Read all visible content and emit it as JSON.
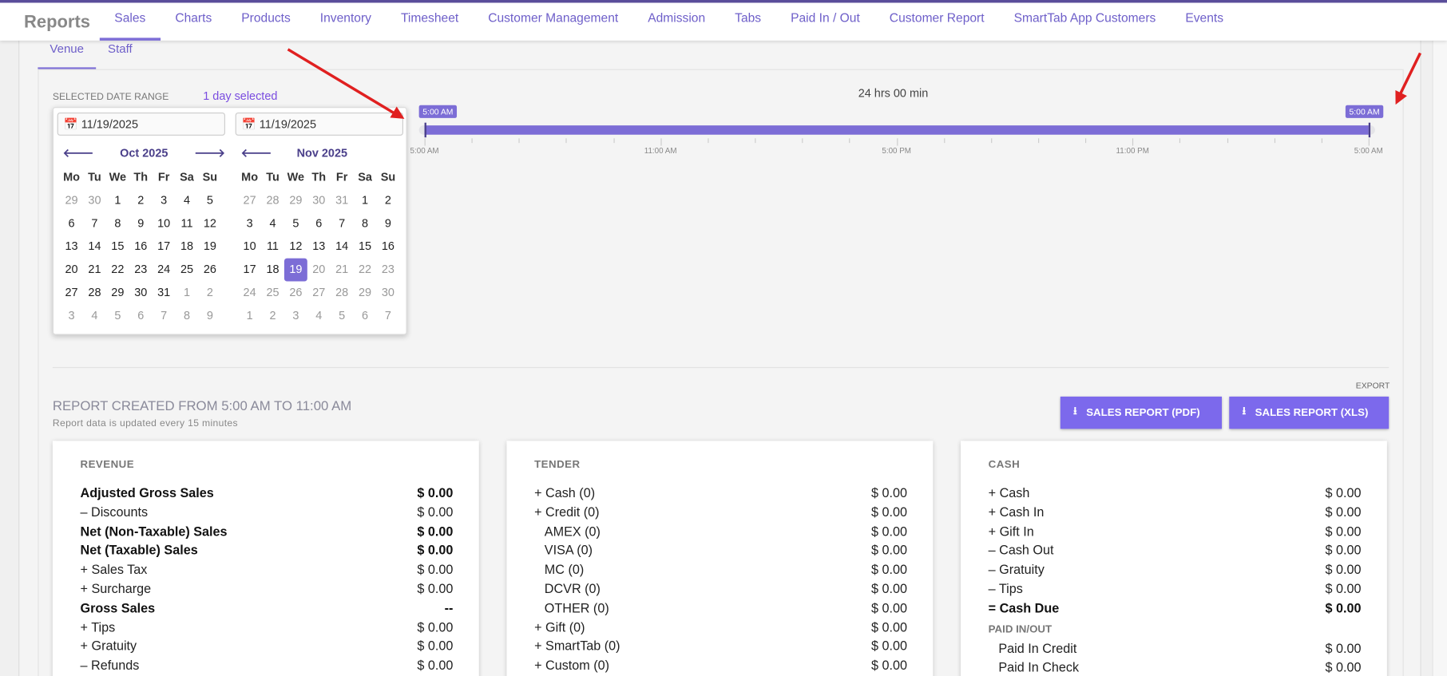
{
  "brand": "Reports",
  "nav": [
    "Sales",
    "Charts",
    "Products",
    "Inventory",
    "Timesheet",
    "Customer Management",
    "Admission",
    "Tabs",
    "Paid In / Out",
    "Customer Report",
    "SmartTab App Customers",
    "Events"
  ],
  "subtabs": [
    "Venue",
    "Staff"
  ],
  "date_range": {
    "label": "SELECTED DATE RANGE",
    "selected": "1 day selected",
    "start": "11/19/2025",
    "end": "11/19/2025"
  },
  "calendars": [
    {
      "title": "Oct 2025",
      "weeks": [
        [
          "29",
          "30",
          "1",
          "2",
          "3",
          "4",
          "5"
        ],
        [
          "6",
          "7",
          "8",
          "9",
          "10",
          "11",
          "12"
        ],
        [
          "13",
          "14",
          "15",
          "16",
          "17",
          "18",
          "19"
        ],
        [
          "20",
          "21",
          "22",
          "23",
          "24",
          "25",
          "26"
        ],
        [
          "27",
          "28",
          "29",
          "30",
          "31",
          "1",
          "2"
        ],
        [
          "3",
          "4",
          "5",
          "6",
          "7",
          "8",
          "9"
        ]
      ]
    },
    {
      "title": "Nov 2025",
      "weeks": [
        [
          "27",
          "28",
          "29",
          "30",
          "31",
          "1",
          "2"
        ],
        [
          "3",
          "4",
          "5",
          "6",
          "7",
          "8",
          "9"
        ],
        [
          "10",
          "11",
          "12",
          "13",
          "14",
          "15",
          "16"
        ],
        [
          "17",
          "18",
          "19",
          "20",
          "21",
          "22",
          "23"
        ],
        [
          "24",
          "25",
          "26",
          "27",
          "28",
          "29",
          "30"
        ],
        [
          "1",
          "2",
          "3",
          "4",
          "5",
          "6",
          "7"
        ]
      ]
    }
  ],
  "weekdays": [
    "Mo",
    "Tu",
    "We",
    "Th",
    "Fr",
    "Sa",
    "Su"
  ],
  "slider": {
    "duration": "24 hrs 00 min",
    "start_label": "5:00 AM",
    "end_label": "5:00 AM",
    "ticks": [
      "5:00 AM",
      "11:00 AM",
      "5:00 PM",
      "11:00 PM",
      "5:00 AM"
    ],
    "start_fraction": 0,
    "end_fraction": 1
  },
  "report": {
    "title": "REPORT CREATED FROM 5:00 AM TO 11:00 AM",
    "subtitle": "Report data is updated every 15 minutes",
    "export_label": "EXPORT",
    "pdf_button": "SALES REPORT (PDF)",
    "xls_button": "SALES REPORT (XLS)"
  },
  "revenue": {
    "title": "REVENUE",
    "rows": [
      [
        "Adjusted Gross Sales",
        "$ 0.00"
      ],
      [
        "– Discounts",
        "$ 0.00"
      ],
      [
        "Net (Non-Taxable) Sales",
        "$ 0.00"
      ],
      [
        "Net (Taxable) Sales",
        "$ 0.00"
      ],
      [
        "+ Sales Tax",
        "$ 0.00"
      ],
      [
        "+ Surcharge",
        "$ 0.00"
      ],
      [
        "Gross Sales",
        "--"
      ],
      [
        "+ Tips",
        "$ 0.00"
      ],
      [
        "+ Gratuity",
        "$ 0.00"
      ],
      [
        "– Refunds",
        "$ 0.00"
      ]
    ]
  },
  "tender": {
    "title": "TENDER",
    "rows": [
      [
        "+ Cash (0)",
        "$ 0.00"
      ],
      [
        "+ Credit (0)",
        "$ 0.00"
      ],
      [
        "AMEX (0)",
        "$ 0.00"
      ],
      [
        "VISA (0)",
        "$ 0.00"
      ],
      [
        "MC (0)",
        "$ 0.00"
      ],
      [
        "DCVR (0)",
        "$ 0.00"
      ],
      [
        "OTHER (0)",
        "$ 0.00"
      ],
      [
        "+ Gift (0)",
        "$ 0.00"
      ],
      [
        "+ SmartTab (0)",
        "$ 0.00"
      ],
      [
        "+ Custom (0)",
        "$ 0.00"
      ]
    ]
  },
  "cash": {
    "title": "CASH",
    "rows": [
      [
        "+ Cash",
        "$ 0.00"
      ],
      [
        "+ Cash In",
        "$ 0.00"
      ],
      [
        "+ Gift In",
        "$ 0.00"
      ],
      [
        "– Cash Out",
        "$ 0.00"
      ],
      [
        "– Gratuity",
        "$ 0.00"
      ],
      [
        "– Tips",
        "$ 0.00"
      ],
      [
        "= Cash Due",
        "$ 0.00"
      ]
    ],
    "paid_title": "PAID IN/OUT",
    "paid_rows": [
      [
        "Paid In Credit",
        "$ 0.00"
      ],
      [
        "Paid In Check",
        "$ 0.00"
      ]
    ]
  }
}
